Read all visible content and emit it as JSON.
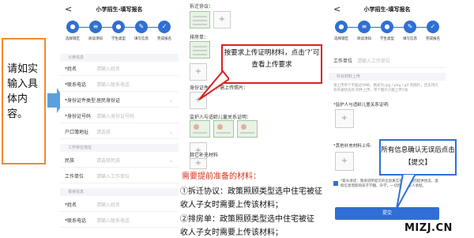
{
  "instruction": {
    "text": "请如实输入具体内容。"
  },
  "left_phone": {
    "title": "小学招生-填写报名",
    "back": "<",
    "steps": [
      "选择辖区",
      "阅读须知",
      "学生类型",
      "填写信息",
      "完成报名"
    ],
    "sections": {
      "guardian": "父亲信息",
      "work": "工作单位地址",
      "mother": "母亲信息"
    },
    "rows": [
      {
        "label": "*姓名",
        "value": "请输入姓名"
      },
      {
        "label": "*联系电话",
        "value": "请输入联系电话"
      },
      {
        "label": "*身份证件类型",
        "value": "居民身份证"
      },
      {
        "label": "*身份证号码",
        "value": "请输入身份证号码"
      },
      {
        "label": "户口簿地址",
        "value": "请选择"
      },
      {
        "label": "民族",
        "value": "请选择民族"
      },
      {
        "label": "工作单位",
        "value": "请输入工作单位"
      },
      {
        "label": "*姓名",
        "value": "请输入姓名"
      },
      {
        "label": "*联系电话",
        "value": "请输入联系电话"
      }
    ]
  },
  "middle": {
    "labels": {
      "demolition": "拆迁协议：",
      "housing": "排房单：",
      "idcard": "身份证件照片-需上传照片：",
      "guardian": "监护人与适龄儿童关系证明：",
      "other": "其它补充材料"
    },
    "callout": "按要求上传证明材料，点击‘?’可查看上传要求",
    "need_title": "需要提前准备的材料：",
    "items": [
      "①拆迁协议：政策照顾类型选中住宅被征",
      "收人子女时需要上传该材料；",
      "②排房单：政策照顾类型选中住宅被征",
      "收人子女时需要上传该材料；"
    ]
  },
  "right_phone": {
    "title": "小学招生-填写报名",
    "back": "<",
    "steps": [
      "选择辖区",
      "阅读须知",
      "学生类型",
      "填写信息",
      "完成报名"
    ],
    "work_label": "工作单位",
    "work_placeholder": "请输入工作单位",
    "upload_section": "补充材料上传",
    "upload_hint": "请上传单个不超过5MB，格式为:jpg / png / gif 的图片，且支持只有开通状态的 附件上传，单个图片只能上传1张",
    "guardian_upload": "*监护人与适龄儿童关系证明:",
    "other_upload": "*其他补充材料上传:",
    "promise": "*家长承诺：我承诺所提交的信息真实有效，如因提供伪造、虚假信息而影响孩子学籍、升学，一切后果由本人承担。",
    "callout": "所有信息确认无误后点击【提交】",
    "submit": "提交"
  },
  "watermark": "MIZJ.CN",
  "colors": {
    "accent": "#2f6fd6",
    "callout_red": "#d22222",
    "instruction_border": "#f08a2b",
    "arrow": "#5aa0de",
    "red_text": "#d8321f"
  }
}
